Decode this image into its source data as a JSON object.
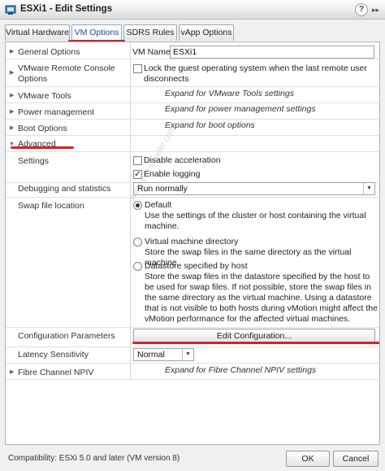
{
  "window": {
    "title": "ESXi1 - Edit Settings",
    "help": "?",
    "expand": "▸▸"
  },
  "tabs": [
    {
      "label": "Virtual Hardware"
    },
    {
      "label": "VM Options"
    },
    {
      "label": "SDRS Rules"
    },
    {
      "label": "vApp Options"
    }
  ],
  "rows": {
    "general": {
      "label": "General Options",
      "field_label": "VM Name:",
      "field_value": "ESXi1"
    },
    "vmrc": {
      "label": "VMware Remote Console Options",
      "option": "Lock the guest operating system when the last remote user disconnects"
    },
    "vmtools": {
      "label": "VMware Tools",
      "note": "Expand for VMware Tools settings"
    },
    "power": {
      "label": "Power management",
      "note": "Expand for power management settings"
    },
    "boot": {
      "label": "Boot Options",
      "note": "Expand for boot options"
    },
    "advanced": {
      "label": "Advanced"
    },
    "settings": {
      "label": "Settings",
      "opt1": "Disable acceleration",
      "opt2": "Enable logging"
    },
    "debug": {
      "label": "Debugging and statistics",
      "value": "Run normally"
    },
    "swap": {
      "label": "Swap file location",
      "opt1": "Default",
      "opt1_desc": "Use the settings of the cluster or host containing the virtual machine.",
      "opt2": "Virtual machine directory",
      "opt2_desc": "Store the swap files in the same directory as the virtual machine.",
      "opt3": "Datastore specified by host",
      "opt3_desc": "Store the swap files in the datastore specified by the host to be used for swap files. If not possible, store the swap files in the same directory as the virtual machine. Using a datastore that is not visible to both hosts during vMotion might affect the vMotion performance for the affected virtual machines."
    },
    "config": {
      "label": "Configuration Parameters",
      "button": "Edit Configuration..."
    },
    "latency": {
      "label": "Latency Sensitivity",
      "value": "Normal"
    },
    "fc": {
      "label": "Fibre Channel NPIV",
      "note": "Expand for Fibre Channel NPIV settings"
    }
  },
  "footer": {
    "compat": "Compatibility: ESXi 5.0 and later (VM version 8)",
    "ok": "OK",
    "cancel": "Cancel"
  },
  "watermark": "www.passleader.com",
  "colors": {
    "accent": "#1a4aa0",
    "highlight": "#d2232a"
  }
}
